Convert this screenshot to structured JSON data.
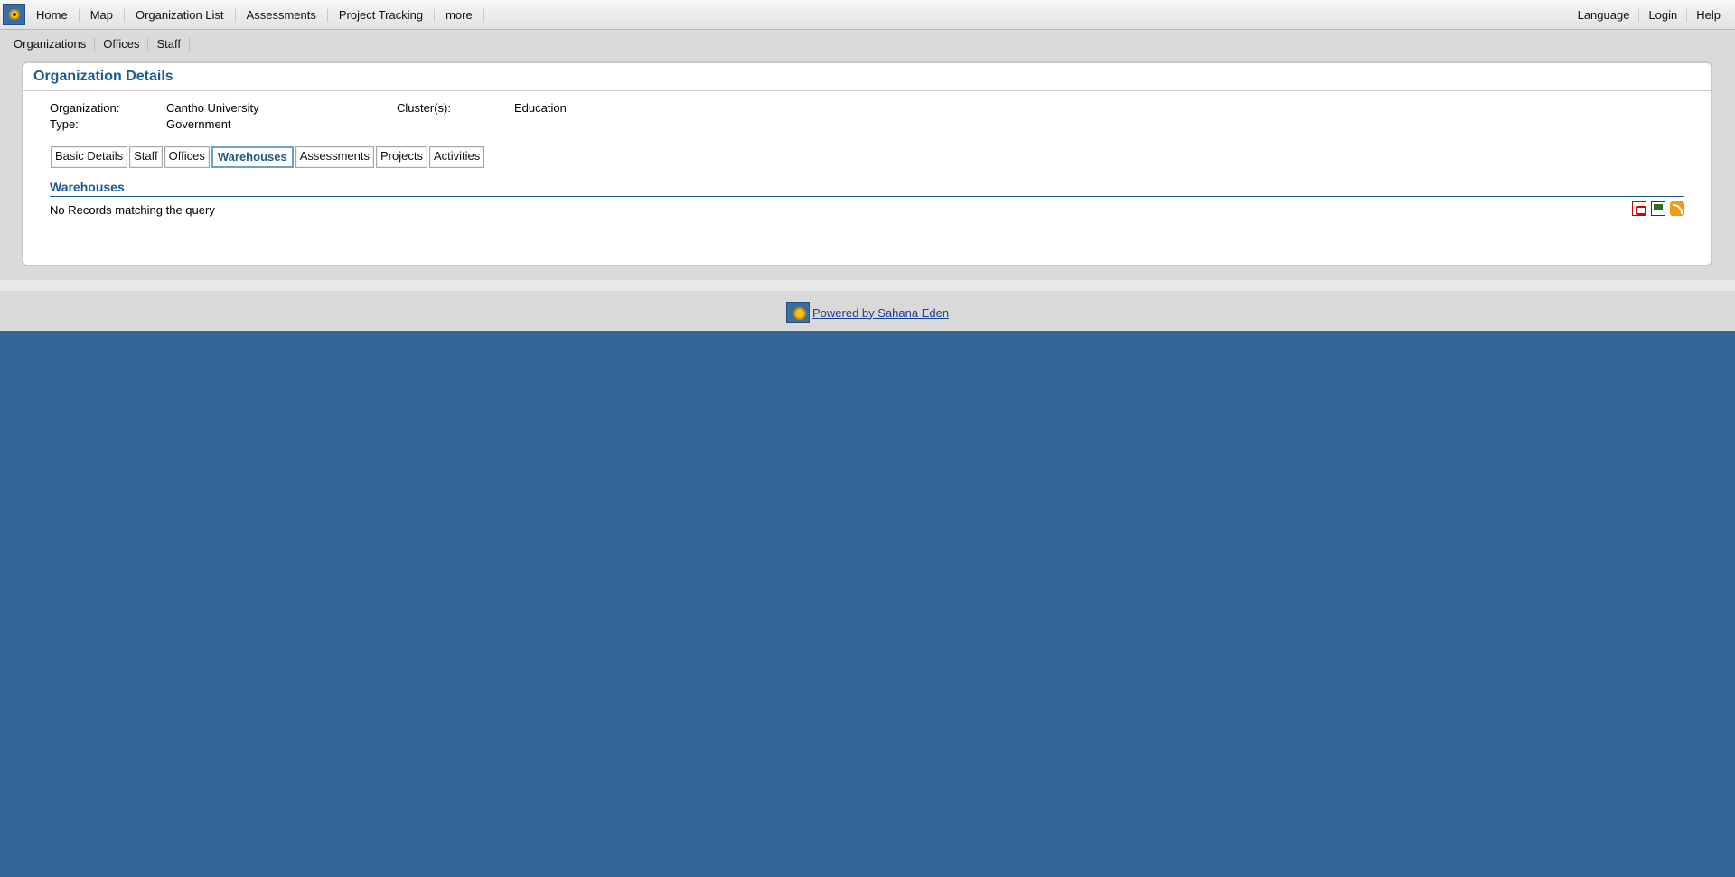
{
  "topbar": {
    "logo": "sahana-logo-icon",
    "left_items": [
      "Home",
      "Map",
      "Organization List",
      "Assessments",
      "Project Tracking",
      "more"
    ],
    "right_items": [
      "Language",
      "Login",
      "Help"
    ]
  },
  "submenu": {
    "items": [
      "Organizations",
      "Offices",
      "Staff"
    ]
  },
  "panel": {
    "title": "Organization Details",
    "details": {
      "organization_label": "Organization:",
      "organization_value": "Cantho University",
      "clusters_label": "Cluster(s):",
      "clusters_value": "Education",
      "type_label": "Type:",
      "type_value": "Government"
    },
    "tabs": [
      "Basic Details",
      "Staff",
      "Offices",
      "Warehouses",
      "Assessments",
      "Projects",
      "Activities"
    ],
    "active_tab": "Warehouses",
    "section_title": "Warehouses",
    "empty_message": "No Records matching the query",
    "export_icons": [
      "pdf-icon",
      "spreadsheet-icon",
      "rss-icon"
    ]
  },
  "footer": {
    "powered_by": "Powered by Sahana Eden"
  },
  "colors": {
    "background": "#336699",
    "accent": "#1a5a92",
    "link": "#1a3d9a"
  }
}
